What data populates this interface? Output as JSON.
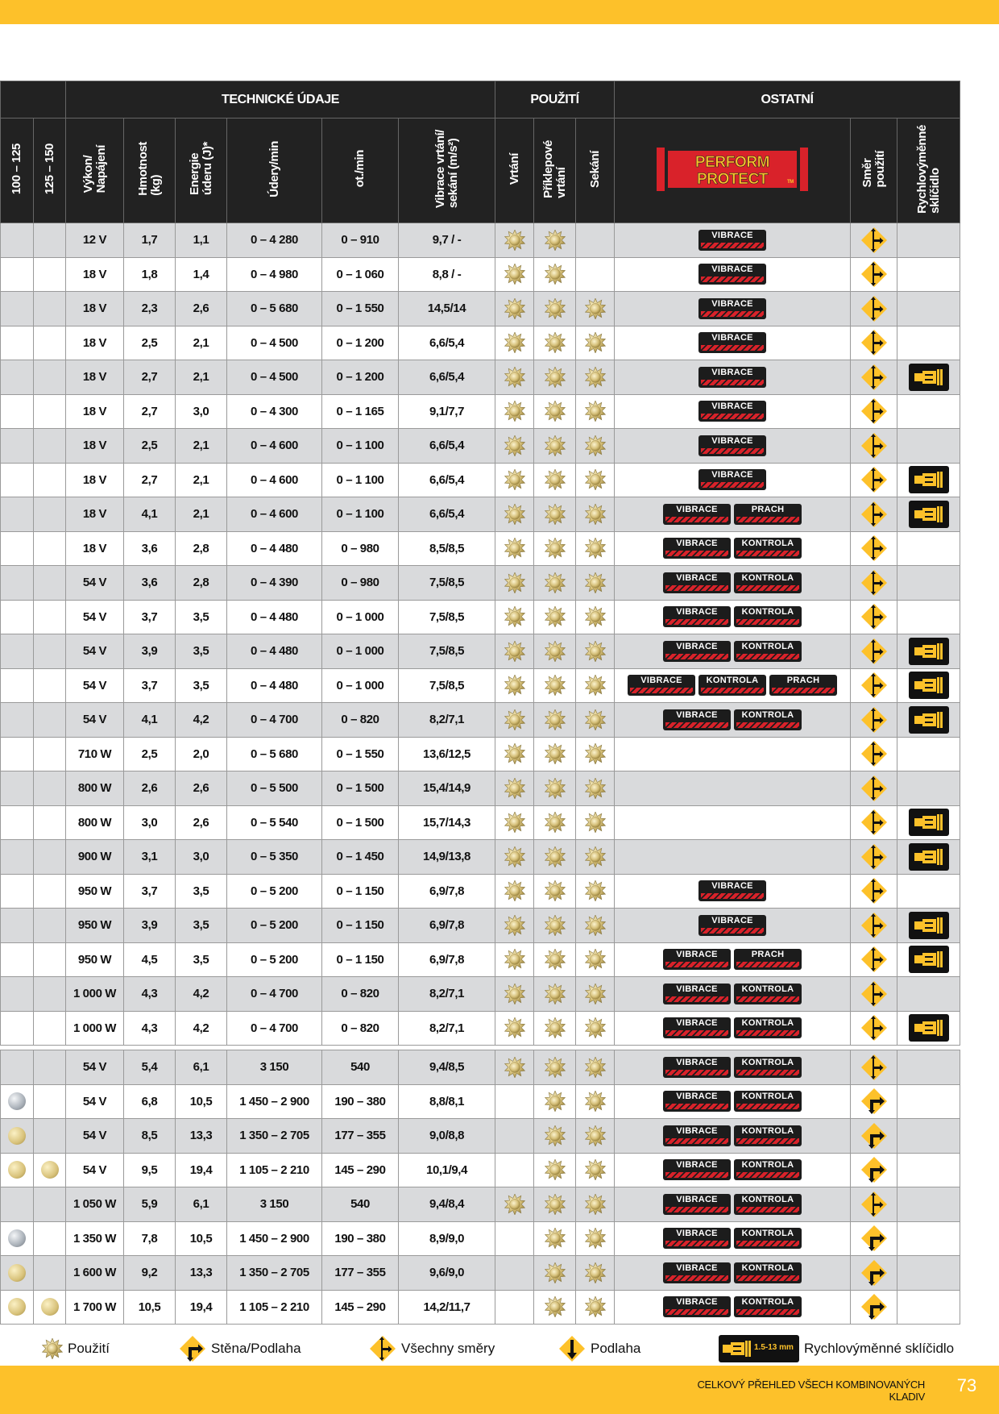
{
  "header": {
    "groups": [
      "TECHNICKÉ ÚDAJE",
      "POUŽITÍ",
      "OSTATNÍ"
    ],
    "columns": [
      "100 – 125",
      "125 – 150",
      "Výkon/\nNapájení",
      "Hmotnost\n(kg)",
      "Energie\núderu (J)*",
      "Údery/min",
      "ot./min",
      "Vibrace vrtání/\nsekání (m/s²)",
      "Vrtání",
      "Příklepové\nvrtání",
      "Sekání",
      "Směr\npoužití",
      "Rychlovýměnné\nsklíčidlo"
    ],
    "logo": {
      "line1": "PERFORM",
      "line2": "PROTECT",
      "tm": "TM"
    }
  },
  "badge_labels": {
    "VIBRACE": "VIBRACE",
    "KONTROLA": "KONTROLA",
    "PRACH": "PRACH"
  },
  "colors": {
    "yellow": "#FDC12A",
    "dark": "#222222",
    "shade": "#D9DADC",
    "red": "#D9222A"
  },
  "rows": [
    {
      "c100": "",
      "c125": "",
      "power": "12 V",
      "weight": "1,7",
      "energy": "1,1",
      "bpm": "0 – 4 280",
      "rpm": "0 – 910",
      "vib": "9,7 / -",
      "drill": true,
      "hammer": true,
      "chisel": false,
      "badges": [
        "VIBRACE"
      ],
      "dir": "all",
      "chuck": false
    },
    {
      "c100": "",
      "c125": "",
      "power": "18 V",
      "weight": "1,8",
      "energy": "1,4",
      "bpm": "0 – 4 980",
      "rpm": "0 – 1 060",
      "vib": "8,8 / -",
      "drill": true,
      "hammer": true,
      "chisel": false,
      "badges": [
        "VIBRACE"
      ],
      "dir": "all",
      "chuck": false
    },
    {
      "c100": "",
      "c125": "",
      "power": "18 V",
      "weight": "2,3",
      "energy": "2,6",
      "bpm": "0 – 5 680",
      "rpm": "0 – 1 550",
      "vib": "14,5/14",
      "drill": true,
      "hammer": true,
      "chisel": true,
      "badges": [
        "VIBRACE"
      ],
      "dir": "all",
      "chuck": false
    },
    {
      "c100": "",
      "c125": "",
      "power": "18 V",
      "weight": "2,5",
      "energy": "2,1",
      "bpm": "0 – 4 500",
      "rpm": "0 – 1 200",
      "vib": "6,6/5,4",
      "drill": true,
      "hammer": true,
      "chisel": true,
      "badges": [
        "VIBRACE"
      ],
      "dir": "all",
      "chuck": false
    },
    {
      "c100": "",
      "c125": "",
      "power": "18 V",
      "weight": "2,7",
      "energy": "2,1",
      "bpm": "0 – 4 500",
      "rpm": "0 – 1 200",
      "vib": "6,6/5,4",
      "drill": true,
      "hammer": true,
      "chisel": true,
      "badges": [
        "VIBRACE"
      ],
      "dir": "all",
      "chuck": true
    },
    {
      "c100": "",
      "c125": "",
      "power": "18 V",
      "weight": "2,7",
      "energy": "3,0",
      "bpm": "0 – 4 300",
      "rpm": "0 – 1 165",
      "vib": "9,1/7,7",
      "drill": true,
      "hammer": true,
      "chisel": true,
      "badges": [
        "VIBRACE"
      ],
      "dir": "all",
      "chuck": false
    },
    {
      "c100": "",
      "c125": "",
      "power": "18 V",
      "weight": "2,5",
      "energy": "2,1",
      "bpm": "0 – 4 600",
      "rpm": "0 – 1 100",
      "vib": "6,6/5,4",
      "drill": true,
      "hammer": true,
      "chisel": true,
      "badges": [
        "VIBRACE"
      ],
      "dir": "all",
      "chuck": false
    },
    {
      "c100": "",
      "c125": "",
      "power": "18 V",
      "weight": "2,7",
      "energy": "2,1",
      "bpm": "0 – 4 600",
      "rpm": "0 – 1 100",
      "vib": "6,6/5,4",
      "drill": true,
      "hammer": true,
      "chisel": true,
      "badges": [
        "VIBRACE"
      ],
      "dir": "all",
      "chuck": true
    },
    {
      "c100": "",
      "c125": "",
      "power": "18 V",
      "weight": "4,1",
      "energy": "2,1",
      "bpm": "0 – 4 600",
      "rpm": "0 – 1 100",
      "vib": "6,6/5,4",
      "drill": true,
      "hammer": true,
      "chisel": true,
      "badges": [
        "VIBRACE",
        "PRACH"
      ],
      "dir": "all",
      "chuck": true
    },
    {
      "c100": "",
      "c125": "",
      "power": "18 V",
      "weight": "3,6",
      "energy": "2,8",
      "bpm": "0 – 4 480",
      "rpm": "0 – 980",
      "vib": "8,5/8,5",
      "drill": true,
      "hammer": true,
      "chisel": true,
      "badges": [
        "VIBRACE",
        "KONTROLA"
      ],
      "dir": "all",
      "chuck": false
    },
    {
      "c100": "",
      "c125": "",
      "power": "54 V",
      "weight": "3,6",
      "energy": "2,8",
      "bpm": "0 – 4 390",
      "rpm": "0 – 980",
      "vib": "7,5/8,5",
      "drill": true,
      "hammer": true,
      "chisel": true,
      "badges": [
        "VIBRACE",
        "KONTROLA"
      ],
      "dir": "all",
      "chuck": false
    },
    {
      "c100": "",
      "c125": "",
      "power": "54 V",
      "weight": "3,7",
      "energy": "3,5",
      "bpm": "0 – 4 480",
      "rpm": "0 – 1 000",
      "vib": "7,5/8,5",
      "drill": true,
      "hammer": true,
      "chisel": true,
      "badges": [
        "VIBRACE",
        "KONTROLA"
      ],
      "dir": "all",
      "chuck": false
    },
    {
      "c100": "",
      "c125": "",
      "power": "54 V",
      "weight": "3,9",
      "energy": "3,5",
      "bpm": "0 – 4 480",
      "rpm": "0 – 1 000",
      "vib": "7,5/8,5",
      "drill": true,
      "hammer": true,
      "chisel": true,
      "badges": [
        "VIBRACE",
        "KONTROLA"
      ],
      "dir": "all",
      "chuck": true
    },
    {
      "c100": "",
      "c125": "",
      "power": "54 V",
      "weight": "3,7",
      "energy": "3,5",
      "bpm": "0 – 4 480",
      "rpm": "0 – 1 000",
      "vib": "7,5/8,5",
      "drill": true,
      "hammer": true,
      "chisel": true,
      "badges": [
        "VIBRACE",
        "KONTROLA",
        "PRACH"
      ],
      "dir": "all",
      "chuck": true
    },
    {
      "c100": "",
      "c125": "",
      "power": "54 V",
      "weight": "4,1",
      "energy": "4,2",
      "bpm": "0 – 4 700",
      "rpm": "0 – 820",
      "vib": "8,2/7,1",
      "drill": true,
      "hammer": true,
      "chisel": true,
      "badges": [
        "VIBRACE",
        "KONTROLA"
      ],
      "dir": "all",
      "chuck": true
    },
    {
      "c100": "",
      "c125": "",
      "power": "710 W",
      "weight": "2,5",
      "energy": "2,0",
      "bpm": "0 – 5 680",
      "rpm": "0 – 1 550",
      "vib": "13,6/12,5",
      "drill": true,
      "hammer": true,
      "chisel": true,
      "badges": [],
      "dir": "all",
      "chuck": false
    },
    {
      "c100": "",
      "c125": "",
      "power": "800 W",
      "weight": "2,6",
      "energy": "2,6",
      "bpm": "0 – 5 500",
      "rpm": "0 – 1 500",
      "vib": "15,4/14,9",
      "drill": true,
      "hammer": true,
      "chisel": true,
      "badges": [],
      "dir": "all",
      "chuck": false
    },
    {
      "c100": "",
      "c125": "",
      "power": "800 W",
      "weight": "3,0",
      "energy": "2,6",
      "bpm": "0 – 5 540",
      "rpm": "0 – 1 500",
      "vib": "15,7/14,3",
      "drill": true,
      "hammer": true,
      "chisel": true,
      "badges": [],
      "dir": "all",
      "chuck": true
    },
    {
      "c100": "",
      "c125": "",
      "power": "900 W",
      "weight": "3,1",
      "energy": "3,0",
      "bpm": "0 – 5 350",
      "rpm": "0 – 1 450",
      "vib": "14,9/13,8",
      "drill": true,
      "hammer": true,
      "chisel": true,
      "badges": [],
      "dir": "all",
      "chuck": true
    },
    {
      "c100": "",
      "c125": "",
      "power": "950 W",
      "weight": "3,7",
      "energy": "3,5",
      "bpm": "0 – 5 200",
      "rpm": "0 – 1 150",
      "vib": "6,9/7,8",
      "drill": true,
      "hammer": true,
      "chisel": true,
      "badges": [
        "VIBRACE"
      ],
      "dir": "all",
      "chuck": false
    },
    {
      "c100": "",
      "c125": "",
      "power": "950 W",
      "weight": "3,9",
      "energy": "3,5",
      "bpm": "0 – 5 200",
      "rpm": "0 – 1 150",
      "vib": "6,9/7,8",
      "drill": true,
      "hammer": true,
      "chisel": true,
      "badges": [
        "VIBRACE"
      ],
      "dir": "all",
      "chuck": true
    },
    {
      "c100": "",
      "c125": "",
      "power": "950 W",
      "weight": "4,5",
      "energy": "3,5",
      "bpm": "0 – 5 200",
      "rpm": "0 – 1 150",
      "vib": "6,9/7,8",
      "drill": true,
      "hammer": true,
      "chisel": true,
      "badges": [
        "VIBRACE",
        "PRACH"
      ],
      "dir": "all",
      "chuck": true
    },
    {
      "c100": "",
      "c125": "",
      "power": "1 000 W",
      "weight": "4,3",
      "energy": "4,2",
      "bpm": "0 – 4 700",
      "rpm": "0 – 820",
      "vib": "8,2/7,1",
      "drill": true,
      "hammer": true,
      "chisel": true,
      "badges": [
        "VIBRACE",
        "KONTROLA"
      ],
      "dir": "all",
      "chuck": false
    },
    {
      "c100": "",
      "c125": "",
      "power": "1 000 W",
      "weight": "4,3",
      "energy": "4,2",
      "bpm": "0 – 4 700",
      "rpm": "0 – 820",
      "vib": "8,2/7,1",
      "drill": true,
      "hammer": true,
      "chisel": true,
      "badges": [
        "VIBRACE",
        "KONTROLA"
      ],
      "dir": "all",
      "chuck": true
    },
    {
      "gap": true
    },
    {
      "c100": "",
      "c125": "",
      "power": "54 V",
      "weight": "5,4",
      "energy": "6,1",
      "bpm": "3 150",
      "rpm": "540",
      "vib": "9,4/8,5",
      "drill": true,
      "hammer": true,
      "chisel": true,
      "badges": [
        "VIBRACE",
        "KONTROLA"
      ],
      "dir": "all",
      "chuck": false
    },
    {
      "c100": "silver",
      "c125": "",
      "power": "54 V",
      "weight": "6,8",
      "energy": "10,5",
      "bpm": "1 450 – 2 900",
      "rpm": "190 – 380",
      "vib": "8,8/8,1",
      "drill": false,
      "hammer": true,
      "chisel": true,
      "badges": [
        "VIBRACE",
        "KONTROLA"
      ],
      "dir": "wall",
      "chuck": false
    },
    {
      "c100": "gold",
      "c125": "",
      "power": "54 V",
      "weight": "8,5",
      "energy": "13,3",
      "bpm": "1 350 – 2 705",
      "rpm": "177 – 355",
      "vib": "9,0/8,8",
      "drill": false,
      "hammer": true,
      "chisel": true,
      "badges": [
        "VIBRACE",
        "KONTROLA"
      ],
      "dir": "wall",
      "chuck": false
    },
    {
      "c100": "gold",
      "c125": "gold",
      "power": "54 V",
      "weight": "9,5",
      "energy": "19,4",
      "bpm": "1 105 – 2 210",
      "rpm": "145 – 290",
      "vib": "10,1/9,4",
      "drill": false,
      "hammer": true,
      "chisel": true,
      "badges": [
        "VIBRACE",
        "KONTROLA"
      ],
      "dir": "wall",
      "chuck": false
    },
    {
      "c100": "",
      "c125": "",
      "power": "1 050 W",
      "weight": "5,9",
      "energy": "6,1",
      "bpm": "3 150",
      "rpm": "540",
      "vib": "9,4/8,4",
      "drill": true,
      "hammer": true,
      "chisel": true,
      "badges": [
        "VIBRACE",
        "KONTROLA"
      ],
      "dir": "all",
      "chuck": false
    },
    {
      "c100": "silver",
      "c125": "",
      "power": "1 350 W",
      "weight": "7,8",
      "energy": "10,5",
      "bpm": "1 450 – 2 900",
      "rpm": "190 – 380",
      "vib": "8,9/9,0",
      "drill": false,
      "hammer": true,
      "chisel": true,
      "badges": [
        "VIBRACE",
        "KONTROLA"
      ],
      "dir": "wall",
      "chuck": false
    },
    {
      "c100": "gold",
      "c125": "",
      "power": "1 600 W",
      "weight": "9,2",
      "energy": "13,3",
      "bpm": "1 350 – 2 705",
      "rpm": "177 – 355",
      "vib": "9,6/9,0",
      "drill": false,
      "hammer": true,
      "chisel": true,
      "badges": [
        "VIBRACE",
        "KONTROLA"
      ],
      "dir": "wall",
      "chuck": false
    },
    {
      "c100": "gold",
      "c125": "gold",
      "power": "1 700 W",
      "weight": "10,5",
      "energy": "19,4",
      "bpm": "1 105 – 2 210",
      "rpm": "145 – 290",
      "vib": "14,2/11,7",
      "drill": false,
      "hammer": true,
      "chisel": true,
      "badges": [
        "VIBRACE",
        "KONTROLA"
      ],
      "dir": "wall",
      "chuck": false
    }
  ],
  "legend": {
    "use": "Použití",
    "wall_floor": "Stěna/Podlaha",
    "all_dirs": "Všechny směry",
    "floor": "Podlaha",
    "chuck_text": "1.5-13 mm",
    "chuck": "Rychlovýměnné sklíčidlo"
  },
  "footer": {
    "title": "CELKOVÝ PŘEHLED VŠECH KOMBINOVANÝCH KLADIV",
    "page": "73"
  }
}
